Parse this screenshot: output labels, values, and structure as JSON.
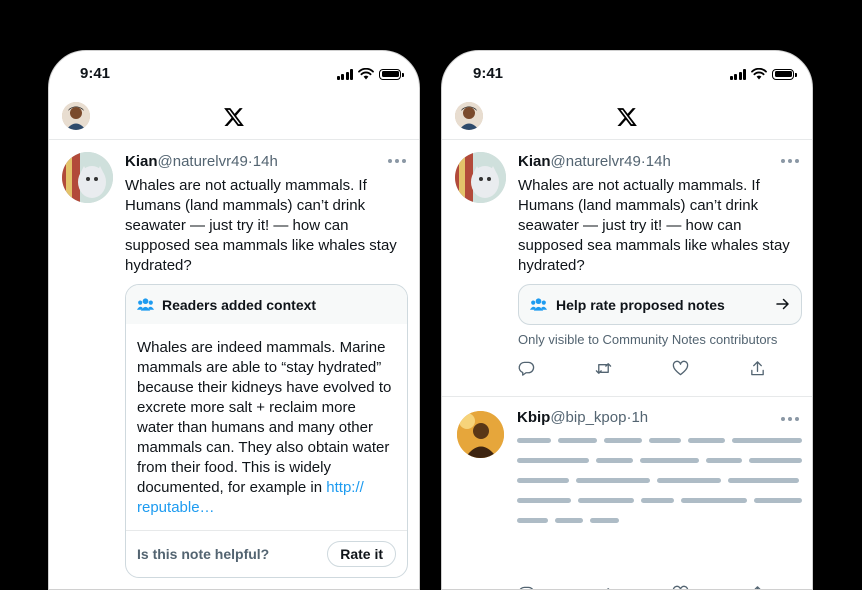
{
  "status": {
    "time": "9:41"
  },
  "tweet": {
    "name": "Kian",
    "handle": "@naturelvr49",
    "dot_time": "·14h",
    "text": "Whales are not actually mammals. If Humans (land mammals) can’t drink seawater — just try it! — how can supposed sea mammals like whales stay hydrated?"
  },
  "note": {
    "title": "Readers added context",
    "body": "Whales are indeed mammals. Marine mammals are able to “stay hydrated” because their kidneys have evolved to excrete more salt + reclaim more water than humans and many other mammals can. They also obtain water from their food. This is widely documented, for example in ",
    "link": "http:// reputable…",
    "helpful_prompt": "Is this note helpful?",
    "rate_label": "Rate it"
  },
  "contributor_prompt": {
    "title": "Help rate proposed notes",
    "visibility": "Only visible to Community Notes contributors"
  },
  "tweet2": {
    "name": "Kbip",
    "handle": "@bip_kpop",
    "dot_time": "·1h"
  },
  "icons": {
    "reply": "reply-icon",
    "retweet": "retweet-icon",
    "like": "like-icon",
    "share": "share-icon",
    "more": "more-icon",
    "community": "people-icon",
    "arrow": "arrow-right-icon",
    "logo": "x-logo-icon"
  },
  "colors": {
    "link": "#1d9bf0",
    "community_icon": "#1d9bf0",
    "skeleton": "#aebcc6"
  }
}
